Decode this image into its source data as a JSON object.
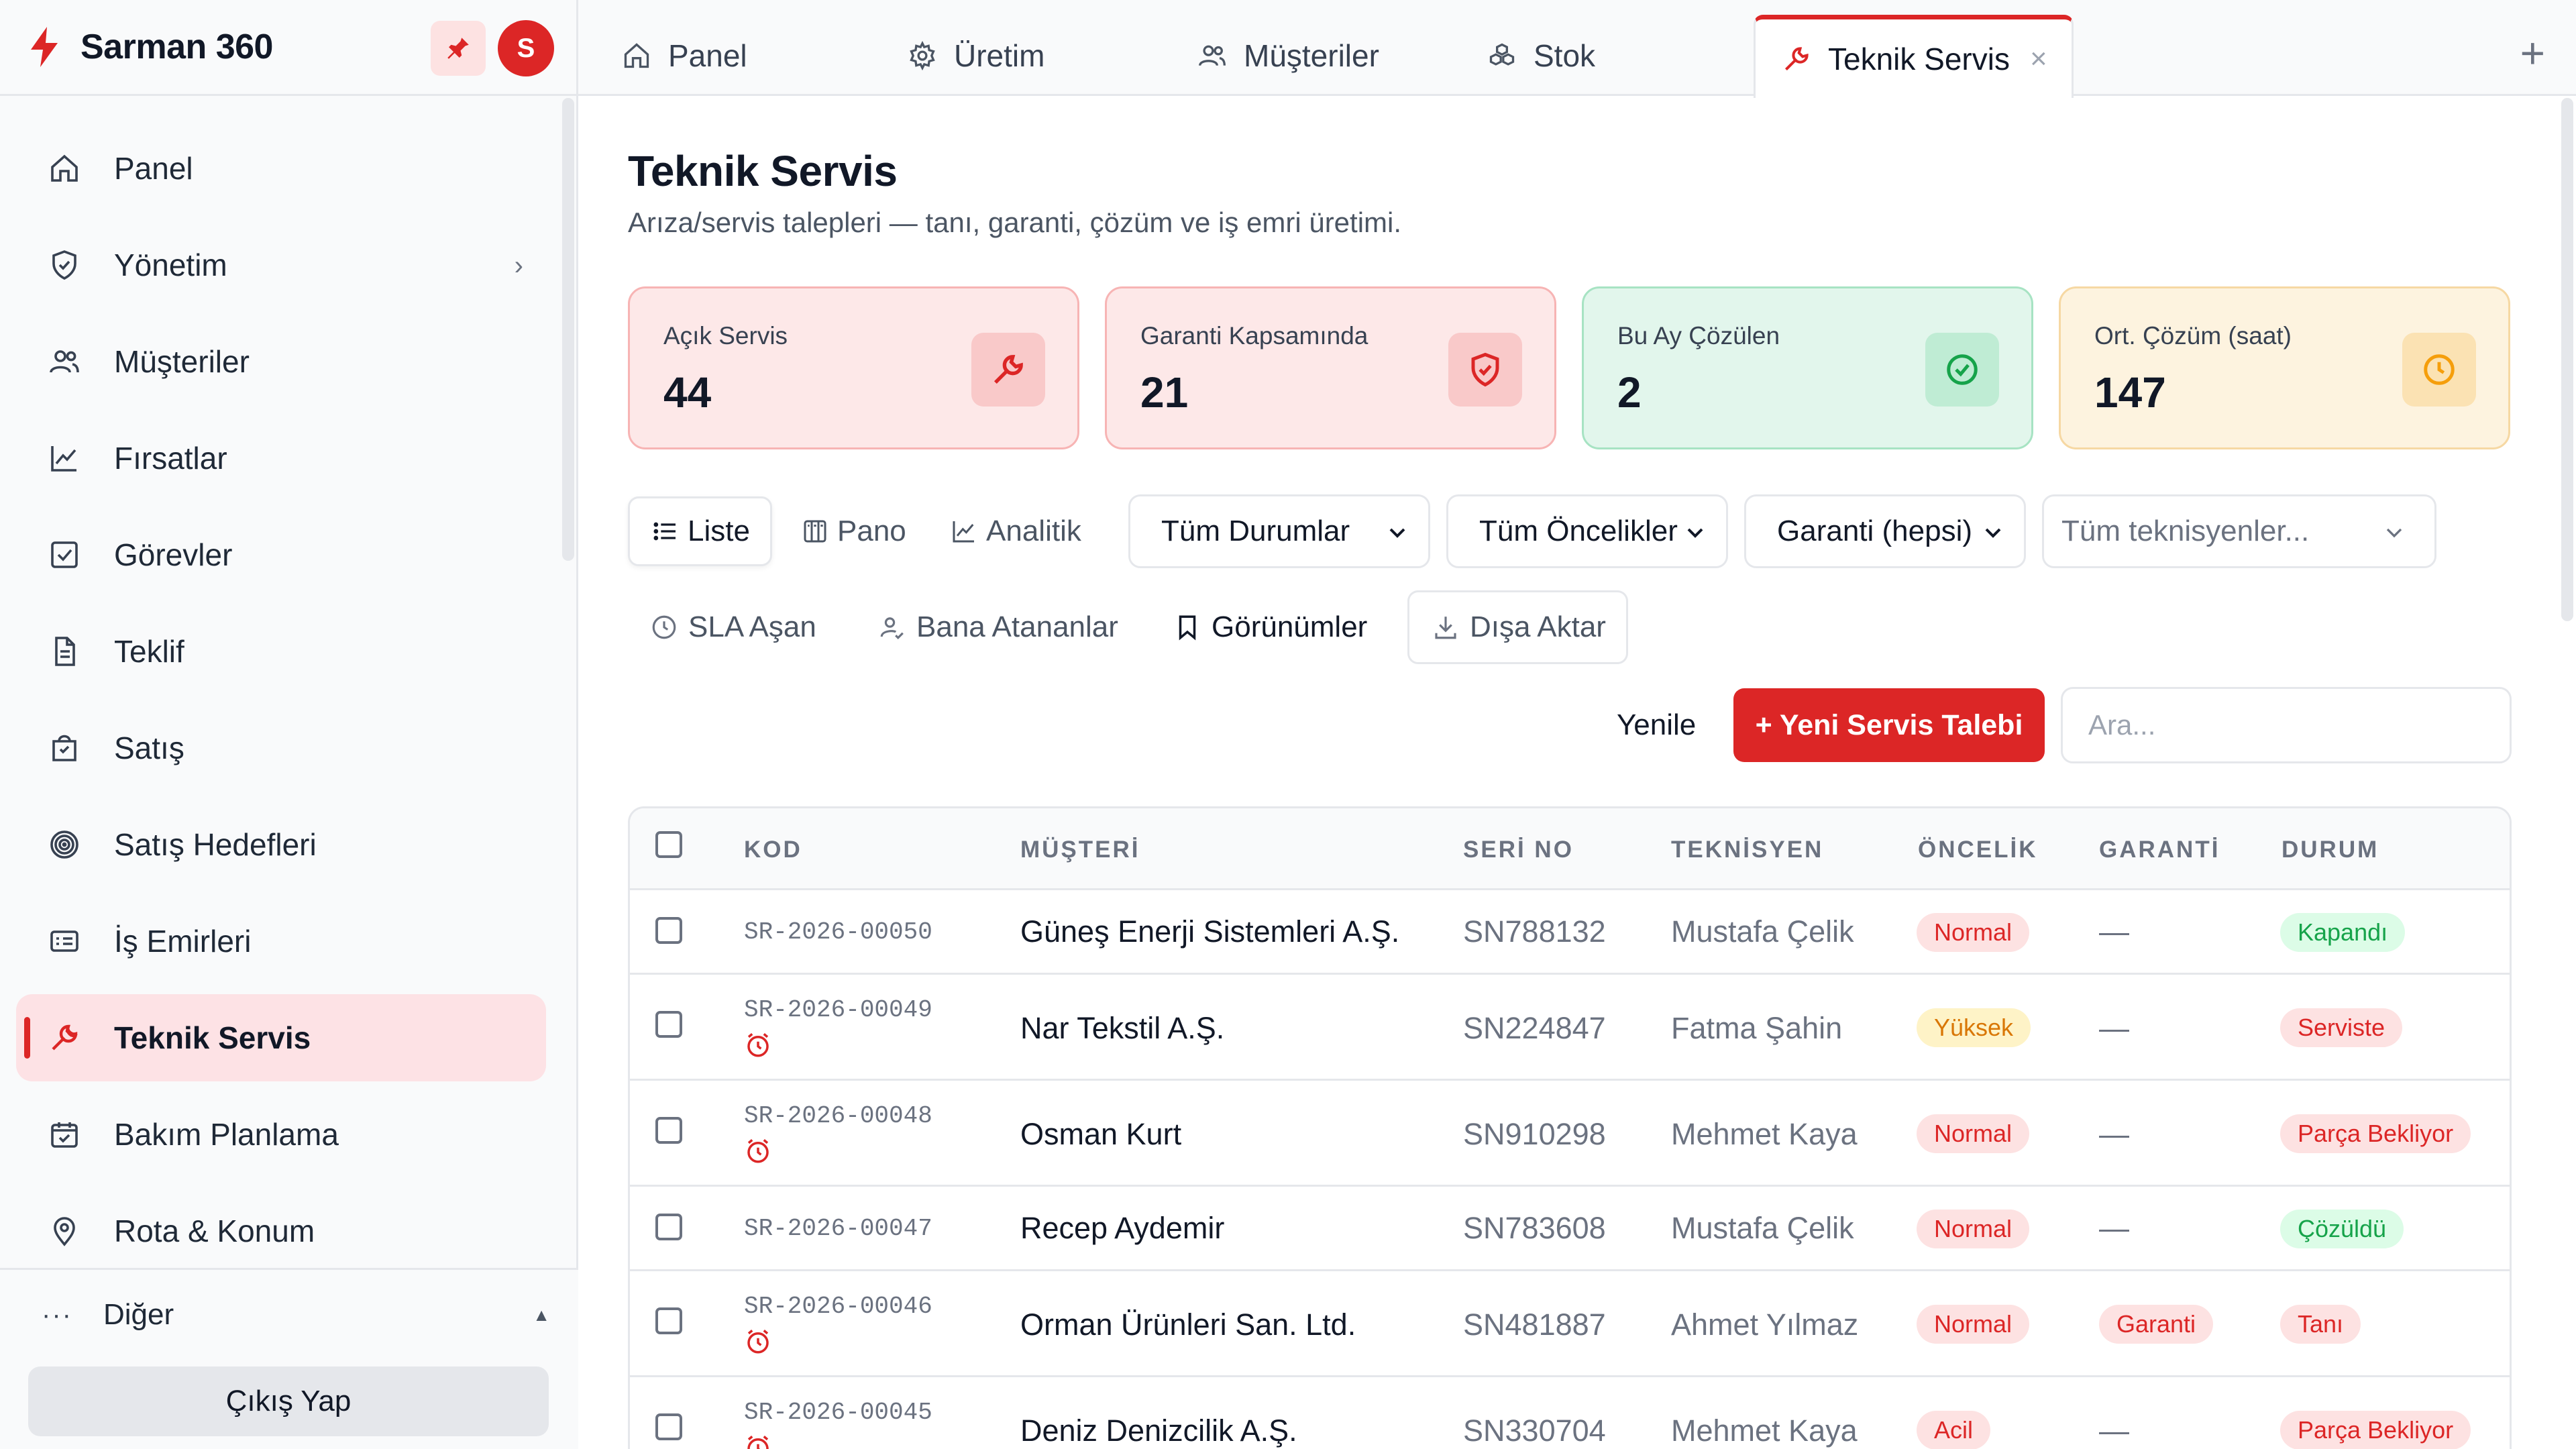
{
  "app": {
    "name": "Sarman 360",
    "avatar_initial": "S",
    "accent": "#dc2626"
  },
  "sidebar": {
    "items": [
      {
        "label": "Panel",
        "icon": "home-icon"
      },
      {
        "label": "Yönetim",
        "icon": "shield-icon",
        "has_children": true
      },
      {
        "label": "Müşteriler",
        "icon": "users-icon"
      },
      {
        "label": "Fırsatlar",
        "icon": "chart-line-icon"
      },
      {
        "label": "Görevler",
        "icon": "checkbox-icon"
      },
      {
        "label": "Teklif",
        "icon": "document-icon"
      },
      {
        "label": "Satış",
        "icon": "shopping-bag-icon"
      },
      {
        "label": "Satış Hedefleri",
        "icon": "target-icon"
      },
      {
        "label": "İş Emirleri",
        "icon": "id-card-icon"
      },
      {
        "label": "Teknik Servis",
        "icon": "wrench-icon",
        "active": true
      },
      {
        "label": "Bakım Planlama",
        "icon": "calendar-check-icon"
      },
      {
        "label": "Rota & Konum",
        "icon": "map-pin-icon"
      }
    ],
    "other_label": "Diğer",
    "logout_label": "Çıkış Yap"
  },
  "tabs": [
    {
      "label": "Panel",
      "icon": "home-icon"
    },
    {
      "label": "Üretim",
      "icon": "gear-icon"
    },
    {
      "label": "Müşteriler",
      "icon": "users-icon"
    },
    {
      "label": "Stok",
      "icon": "boxes-icon"
    },
    {
      "label": "Teknik Servis",
      "icon": "wrench-icon",
      "active": true
    }
  ],
  "page": {
    "title": "Teknik Servis",
    "subtitle": "Arıza/servis talepleri — tanı, garanti, çözüm ve iş emri üretimi."
  },
  "stats": [
    {
      "label": "Açık Servis",
      "value": "44",
      "icon": "wrench-icon",
      "tone": "red"
    },
    {
      "label": "Garanti Kapsamında",
      "value": "21",
      "icon": "shield-icon",
      "tone": "red"
    },
    {
      "label": "Bu Ay Çözülen",
      "value": "2",
      "icon": "check-circle-icon",
      "tone": "green"
    },
    {
      "label": "Ort. Çözüm (saat)",
      "value": "147",
      "icon": "clock-icon",
      "tone": "amber"
    }
  ],
  "views": {
    "list": "Liste",
    "board": "Pano",
    "analytics": "Analitik"
  },
  "filters": {
    "status": "Tüm Durumlar",
    "priority": "Tüm Öncelikler",
    "warranty": "Garanti (hepsi)",
    "technician_placeholder": "Tüm teknisyenler..."
  },
  "quick": {
    "sla": "SLA Aşan",
    "assigned": "Bana Atananlar",
    "views": "Görünümler",
    "export": "Dışa Aktar"
  },
  "actions": {
    "refresh": "Yenile",
    "new": "+ Yeni Servis Talebi",
    "search_placeholder": "Ara..."
  },
  "table": {
    "columns": [
      "KOD",
      "MÜŞTERİ",
      "SERİ NO",
      "TEKNİSYEN",
      "ÖNCELİK",
      "GARANTİ",
      "DURUM"
    ],
    "rows": [
      {
        "code": "SR-2026-00050",
        "customer": "Güneş Enerji Sistemleri A.Ş.",
        "serial": "SN788132",
        "technician": "Mustafa Çelik",
        "priority": "Normal",
        "warranty": "—",
        "status": "Kapandı",
        "sla": false
      },
      {
        "code": "SR-2026-00049",
        "customer": "Nar Tekstil A.Ş.",
        "serial": "SN224847",
        "technician": "Fatma Şahin",
        "priority": "Yüksek",
        "warranty": "—",
        "status": "Serviste",
        "sla": true
      },
      {
        "code": "SR-2026-00048",
        "customer": "Osman Kurt",
        "serial": "SN910298",
        "technician": "Mehmet Kaya",
        "priority": "Normal",
        "warranty": "—",
        "status": "Parça Bekliyor",
        "sla": true
      },
      {
        "code": "SR-2026-00047",
        "customer": "Recep Aydemir",
        "serial": "SN783608",
        "technician": "Mustafa Çelik",
        "priority": "Normal",
        "warranty": "—",
        "status": "Çözüldü",
        "sla": false
      },
      {
        "code": "SR-2026-00046",
        "customer": "Orman Ürünleri San. Ltd.",
        "serial": "SN481887",
        "technician": "Ahmet Yılmaz",
        "priority": "Normal",
        "warranty": "Garanti",
        "status": "Tanı",
        "sla": true
      },
      {
        "code": "SR-2026-00045",
        "customer": "Deniz Denizcilik A.Ş.",
        "serial": "SN330704",
        "technician": "Mehmet Kaya",
        "priority": "Acil",
        "warranty": "—",
        "status": "Parça Bekliyor",
        "sla": true
      }
    ]
  }
}
